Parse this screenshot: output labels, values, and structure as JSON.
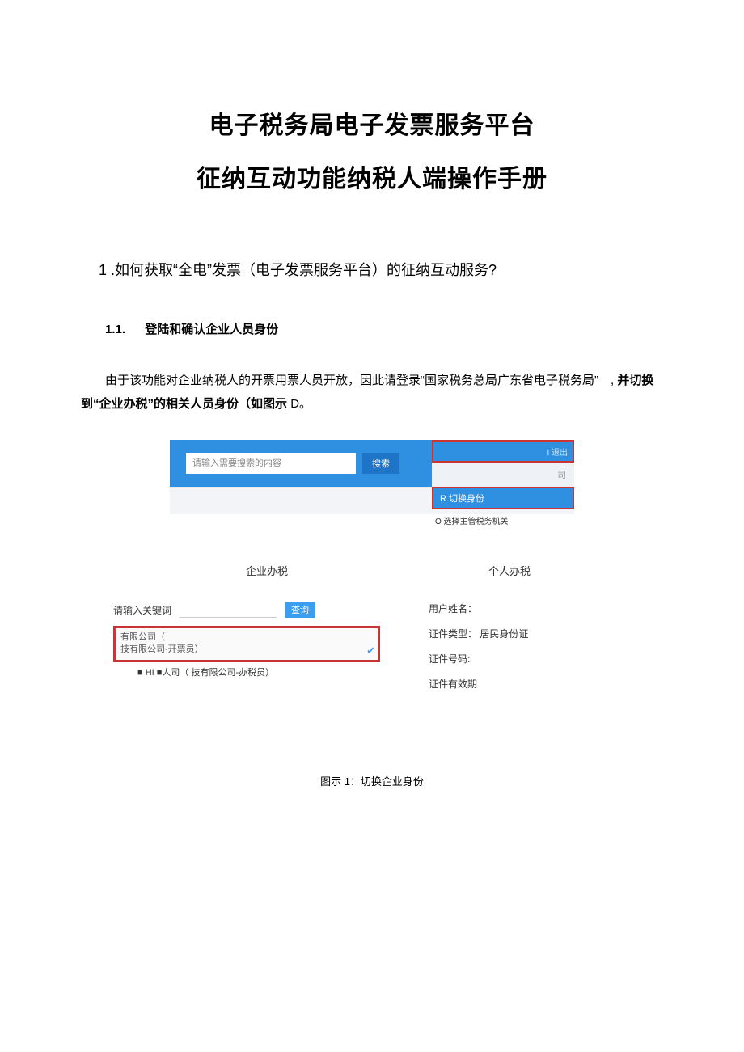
{
  "title": {
    "line1": "电子税务局电子发票服务平台",
    "line2": "征纳互动功能纳税人端操作手册"
  },
  "section1": {
    "number": "1",
    "text": ".如何获取“全电”发票（电子发票服务平台）的征纳互动服务?"
  },
  "subsection11": {
    "number": "1.1.",
    "text": "登陆和确认企业人员身份"
  },
  "para1": {
    "before_bold": "由于该功能对企业纳税人的开票用票人员开放，因此请登录“国家税务总局广东省电子税务局”　,",
    "bold": "并切换到“企业办税”的相关人员身份（如图示",
    "after_bold": " D。"
  },
  "shot1": {
    "search_placeholder": "请输入需要搜索的内容",
    "search_btn": "搜索",
    "logout": "I 退出",
    "user_suffix": "司",
    "switch": "R 切换身份",
    "select_org": "O 选择主管税务机关"
  },
  "shot2": {
    "tab_left": "企业办税",
    "tab_right": "个人办税",
    "kw_label": "请输入关键词",
    "kw_btn": "查询",
    "company_line1_a": "有限公司（",
    "company_line1_b": "技有限公司-开票员）",
    "company_line2": "■ HI ■人司（  技有限公司-办税员）",
    "info": {
      "name_label": "用户姓名：",
      "idtype_label": "证件类型：",
      "idtype_value": "居民身份证",
      "idno_label": "证件号码:",
      "valid_label": "证件有效期"
    }
  },
  "caption": "图示 1：切换企业身份"
}
